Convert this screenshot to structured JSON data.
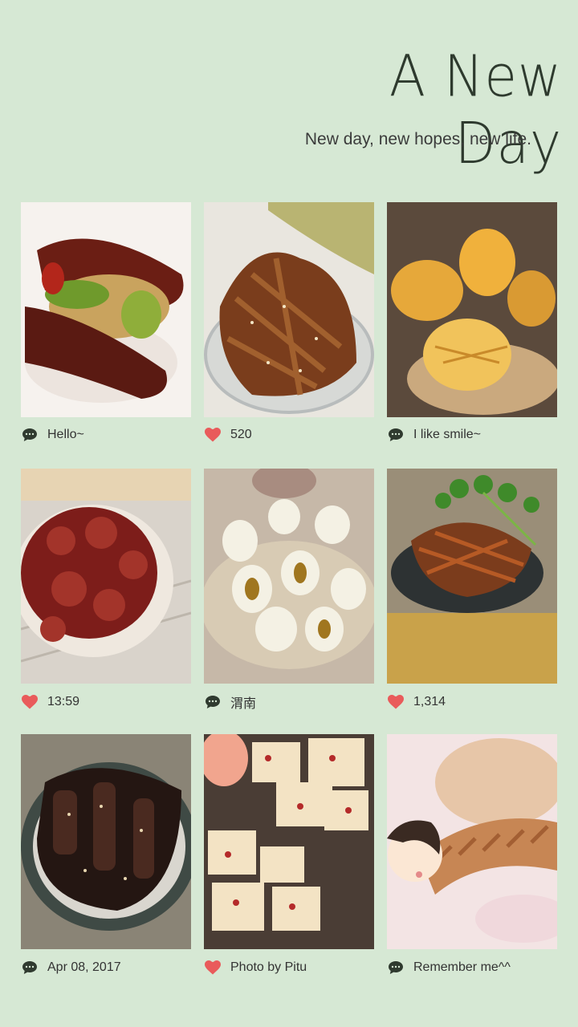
{
  "header": {
    "title": "A New Day",
    "subtitle": "New day, new hopes, new life."
  },
  "grid": [
    {
      "caption": "Hello~",
      "icon": "comment-icon"
    },
    {
      "caption": "520",
      "icon": "heart-icon"
    },
    {
      "caption": "I like smile~",
      "icon": "comment-icon"
    },
    {
      "caption": "13:59",
      "icon": "heart-icon"
    },
    {
      "caption": "渭南",
      "icon": "comment-icon"
    },
    {
      "caption": "1,314",
      "icon": "heart-icon"
    },
    {
      "caption": "Apr 08, 2017",
      "icon": "comment-icon"
    },
    {
      "caption": "Photo by Pitu",
      "icon": "heart-icon"
    },
    {
      "caption": "Remember me^^",
      "icon": "comment-icon"
    }
  ],
  "colors": {
    "background": "#d6e8d4",
    "heart": "#e95b5b",
    "comment": "#2f3a2f"
  }
}
